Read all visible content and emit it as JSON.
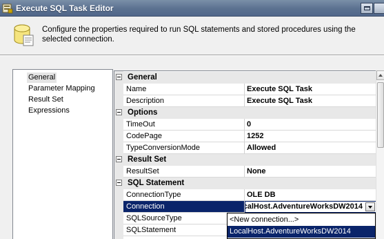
{
  "window": {
    "title": "Execute SQL Task Editor",
    "icons": {
      "app": "app-icon",
      "header": "database-icon"
    }
  },
  "header": {
    "description": "Configure the properties required to run SQL statements and stored procedures using the selected connection."
  },
  "nav": {
    "items": [
      {
        "label": "General",
        "selected": true
      },
      {
        "label": "Parameter Mapping",
        "selected": false
      },
      {
        "label": "Result Set",
        "selected": false
      },
      {
        "label": "Expressions",
        "selected": false
      }
    ]
  },
  "grid": {
    "categories": {
      "general": "General",
      "options": "Options",
      "result_set": "Result Set",
      "sql_statement": "SQL Statement"
    },
    "props": {
      "name": {
        "name": "Name",
        "value": "Execute SQL Task"
      },
      "description": {
        "name": "Description",
        "value": "Execute SQL Task"
      },
      "timeout": {
        "name": "TimeOut",
        "value": "0"
      },
      "codepage": {
        "name": "CodePage",
        "value": "1252"
      },
      "type_conversion": {
        "name": "TypeConversionMode",
        "value": "Allowed"
      },
      "resultset": {
        "name": "ResultSet",
        "value": "None"
      },
      "connection_type": {
        "name": "ConnectionType",
        "value": "OLE DB"
      },
      "connection": {
        "name": "Connection",
        "value": "LocalHost.AdventureWorksDW2014"
      },
      "sql_source_type": {
        "name": "SQLSourceType",
        "value": ""
      },
      "sql_statement": {
        "name": "SQLStatement",
        "value": ""
      }
    }
  },
  "dropdown": {
    "options": [
      "<New connection...>",
      "LocalHost.AdventureWorksDW2014"
    ],
    "highlighted_index": 1
  },
  "colors": {
    "selection": "#0a246a",
    "titlebar": "#5b7190",
    "category_bg": "#e8e8e8"
  }
}
